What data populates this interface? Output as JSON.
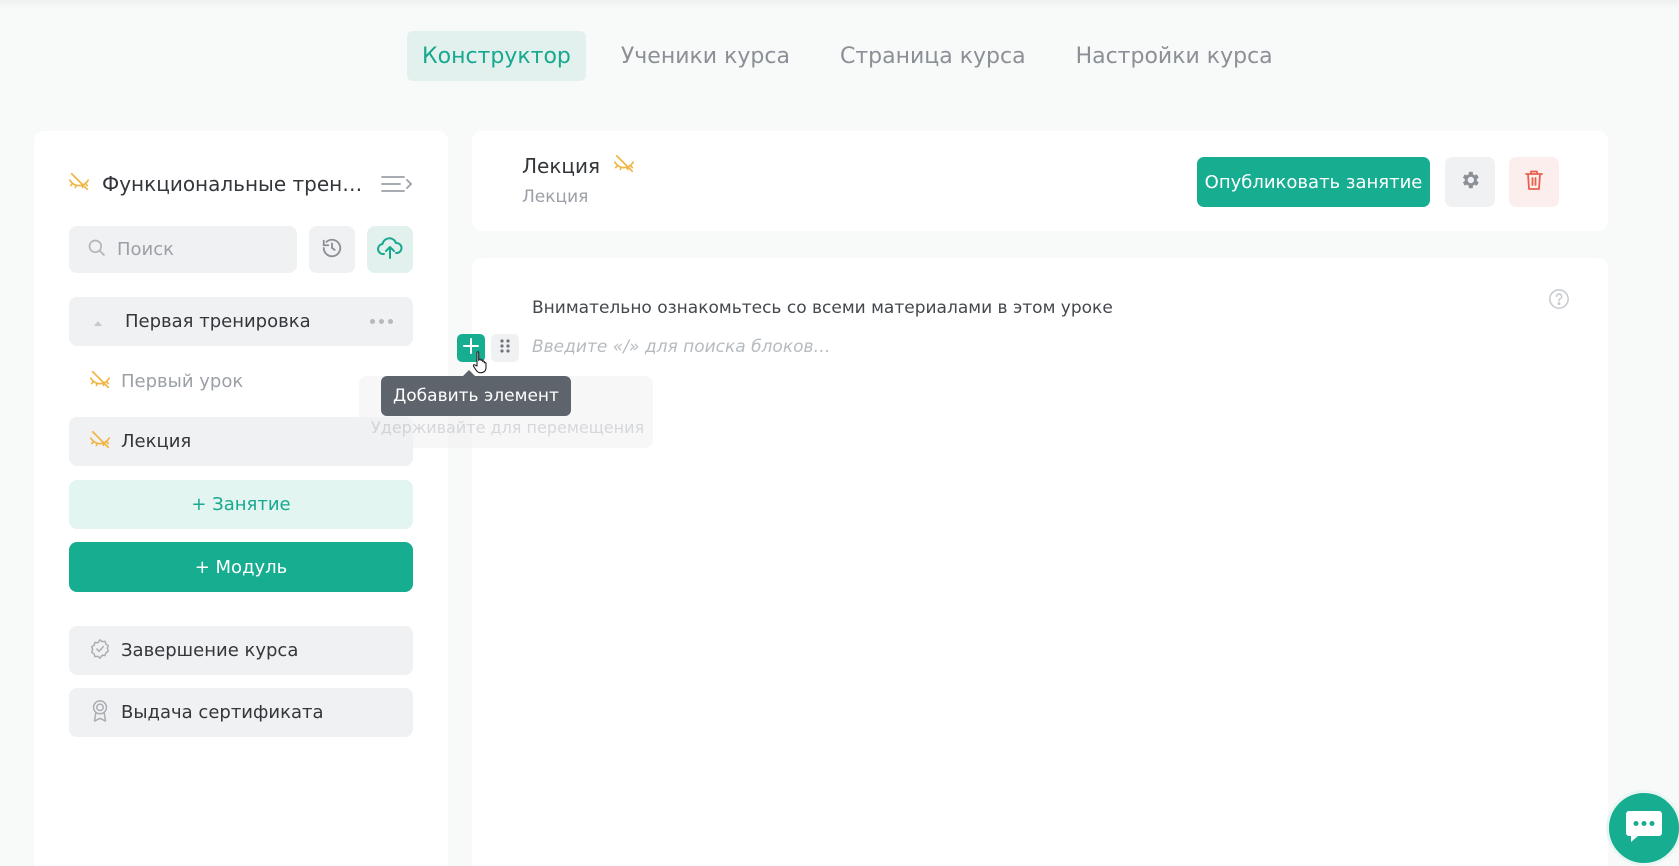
{
  "tabs": [
    {
      "label": "Конструктор",
      "active": true
    },
    {
      "label": "Ученики курса",
      "active": false
    },
    {
      "label": "Страница курса",
      "active": false
    },
    {
      "label": "Настройки курса",
      "active": false
    }
  ],
  "sidebar": {
    "course_title": "Функциональные трени...",
    "search": {
      "placeholder": "Поиск",
      "value": ""
    },
    "module": {
      "title": "Первая тренировка"
    },
    "lessons": [
      {
        "label": "Первый урок",
        "hidden": true
      },
      {
        "label": "Лекция",
        "hidden": true,
        "selected": true
      }
    ],
    "add_lesson_label": "+ Занятие",
    "add_module_label": "+ Модуль",
    "finish_label": "Завершение курса",
    "certificate_label": "Выдача сертификата"
  },
  "lesson": {
    "title": "Лекция",
    "subtitle": "Лекция",
    "publish_label": "Опубликовать занятие"
  },
  "editor": {
    "intro_text": "Внимательно ознакомьтесь со всеми материалами в этом уроке",
    "placeholder": "Введите «/» для поиска блоков…",
    "tooltip": "Добавить элемент",
    "drag_hint": "Удерживайте для перемещения"
  },
  "colors": {
    "accent": "#17ad91",
    "accent_light": "#e3f1ee",
    "warning_icon": "#f2b441",
    "danger": "#e8604c"
  },
  "icons": {
    "hidden": "eye-off-icon",
    "collapse": "collapse-menu-icon",
    "search": "search-icon",
    "history": "history-icon",
    "upload": "cloud-upload-icon",
    "settings": "gear-icon",
    "delete": "trash-icon",
    "help": "help-icon",
    "chat": "chat-icon"
  }
}
